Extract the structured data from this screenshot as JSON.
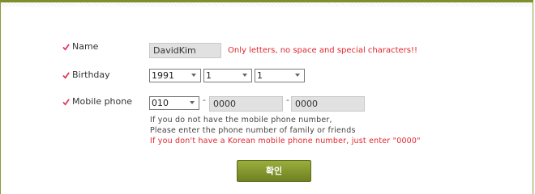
{
  "form": {
    "name": {
      "label": "Name",
      "value": "DavidKim",
      "error": "Only letters, no space and special characters!!"
    },
    "birthday": {
      "label": "Birthday",
      "year": "1991",
      "month": "1",
      "day": "1"
    },
    "mobile": {
      "label": "Mobile phone",
      "prefix": "010",
      "dash": "-",
      "part1_placeholder": "0000",
      "part2_placeholder": "0000",
      "hint_line1": "If you do not have the mobile phone number,",
      "hint_line2": "Please enter the phone number of family or friends",
      "hint_line3": "If you don't have a Korean mobile phone number, just enter \"0000\""
    },
    "confirm_label": "확인"
  },
  "colors": {
    "accent_check": "#e0395f",
    "error_text": "#e0262c",
    "button_green": "#7f9130",
    "frame_green": "#7f8f2c"
  },
  "icons": {
    "check": "checkmark-icon",
    "dropdown": "chevron-down-icon"
  }
}
